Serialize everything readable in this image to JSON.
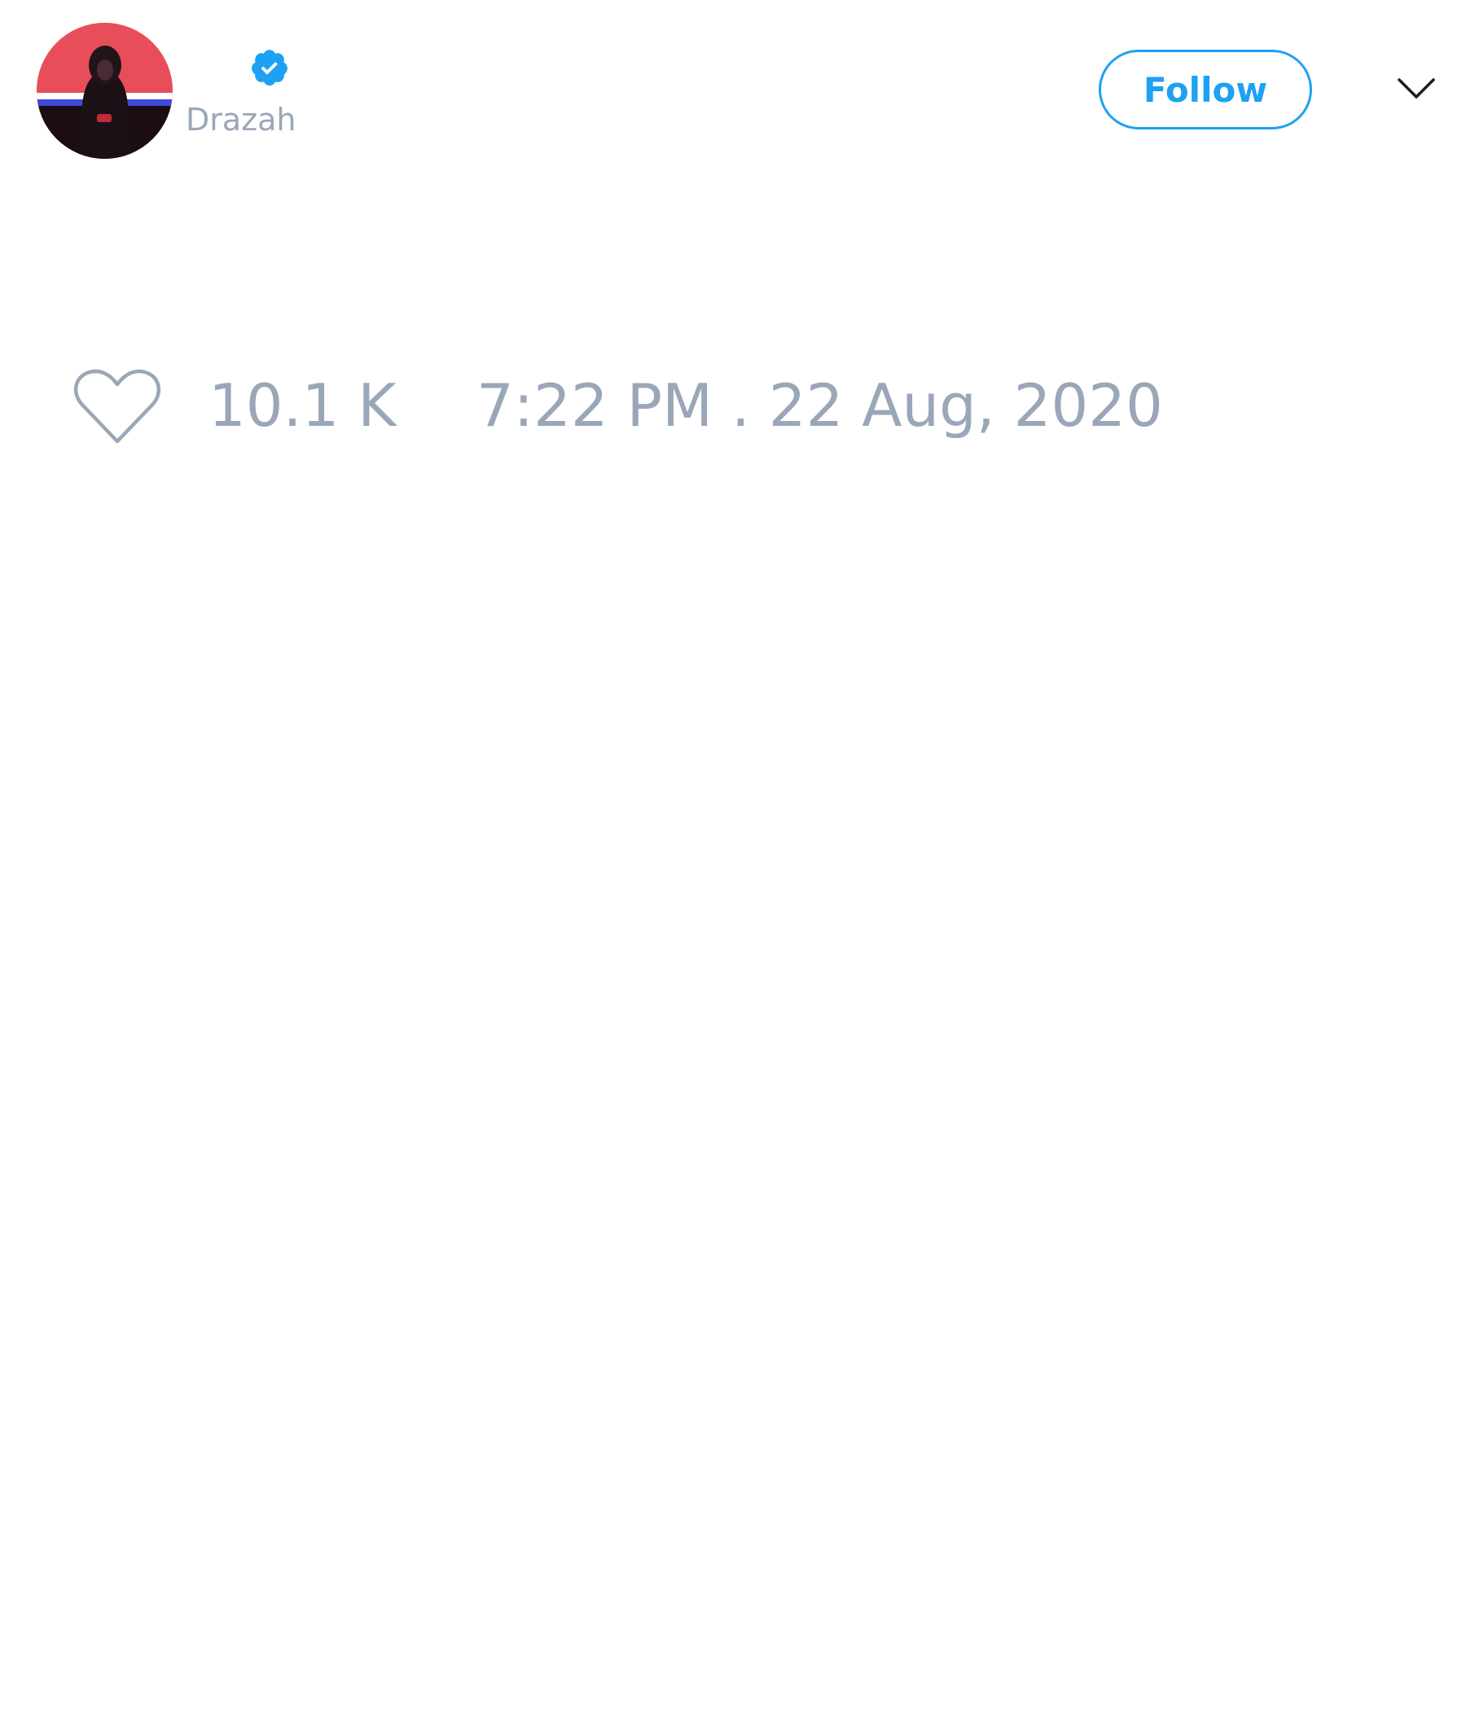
{
  "author": {
    "handle": "Drazah",
    "verified": true
  },
  "actions": {
    "follow_label": "Follow"
  },
  "stats": {
    "likes": "10.1 K",
    "timestamp": "7:22 PM . 22 Aug, 2020"
  },
  "icons": {
    "verified": "verified-badge-icon",
    "more": "chevron-down-icon",
    "like": "heart-icon"
  },
  "colors": {
    "accent": "#1da1f2",
    "muted_text": "#9aa7b8",
    "background": "#ffffff"
  }
}
